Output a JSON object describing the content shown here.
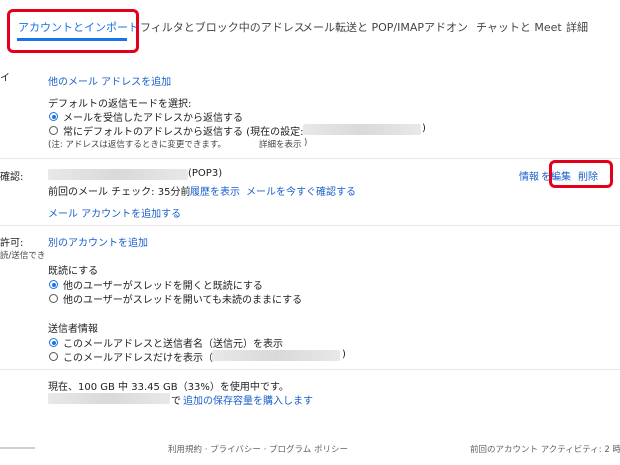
{
  "tabs": [
    {
      "label": "アカウントとインポート"
    },
    {
      "label": "フィルタとブロック中のアドレス"
    },
    {
      "label": "メール転送と POP/IMAP"
    },
    {
      "label": "アドオン"
    },
    {
      "label": "チャットと Meet"
    },
    {
      "label": "詳細"
    }
  ],
  "left_fragments": {
    "row1": "イ",
    "row2": "確認:",
    "row3": "許可:",
    "row3b": "読/送信でき"
  },
  "send_as": {
    "add_address_link": "他のメール アドレスを追加",
    "reply_mode_title": "デフォルトの返信モードを選択:",
    "option1": "メールを受信したアドレスから返信する",
    "option2_prefix": "常にデフォルトのアドレスから返信する (現在の設定:",
    "option2_suffix": ")",
    "note": "(注: アドレスは返信するときに変更できます。",
    "note_link": "詳細を表示",
    "note_end": ")"
  },
  "check_mail": {
    "account_suffix": "(POP3)",
    "last_check": "前回のメール チェック: 35分前",
    "history_link": "履歴を表示",
    "check_now_link": "メールを今すぐ確認する",
    "add_account_link": "メール アカウントを追加する",
    "info_link": "情報",
    "edit_link": "を編集",
    "delete_link": "削除"
  },
  "grant_access": {
    "add_another_link": "別のアカウントを追加",
    "mark_read_title": "既読にする",
    "mark_read_opt1": "他のユーザーがスレッドを開くと既読にする",
    "mark_read_opt2": "他のユーザーがスレッドを開いても未読のままにする",
    "sender_info_title": "送信者情報",
    "sender_opt1": "このメールアドレスと送信者名（送信元）を表示",
    "sender_opt2_prefix": "このメールアドレスだけを表示（",
    "sender_opt2_suffix": ")"
  },
  "storage": {
    "usage": "現在、100 GB 中 33.45 GB（33%）を使用中です。",
    "by": "で",
    "buy_link": "追加の保存容量を購入します"
  },
  "footer": {
    "policy": "利用規約 · プライバシー · プログラム ポリシー",
    "activity": "前回のアカウント アクティビティ: 2 時"
  },
  "colors": {
    "accent": "#1a73e8",
    "link": "#1a5fcc",
    "highlight": "#e3001b"
  }
}
